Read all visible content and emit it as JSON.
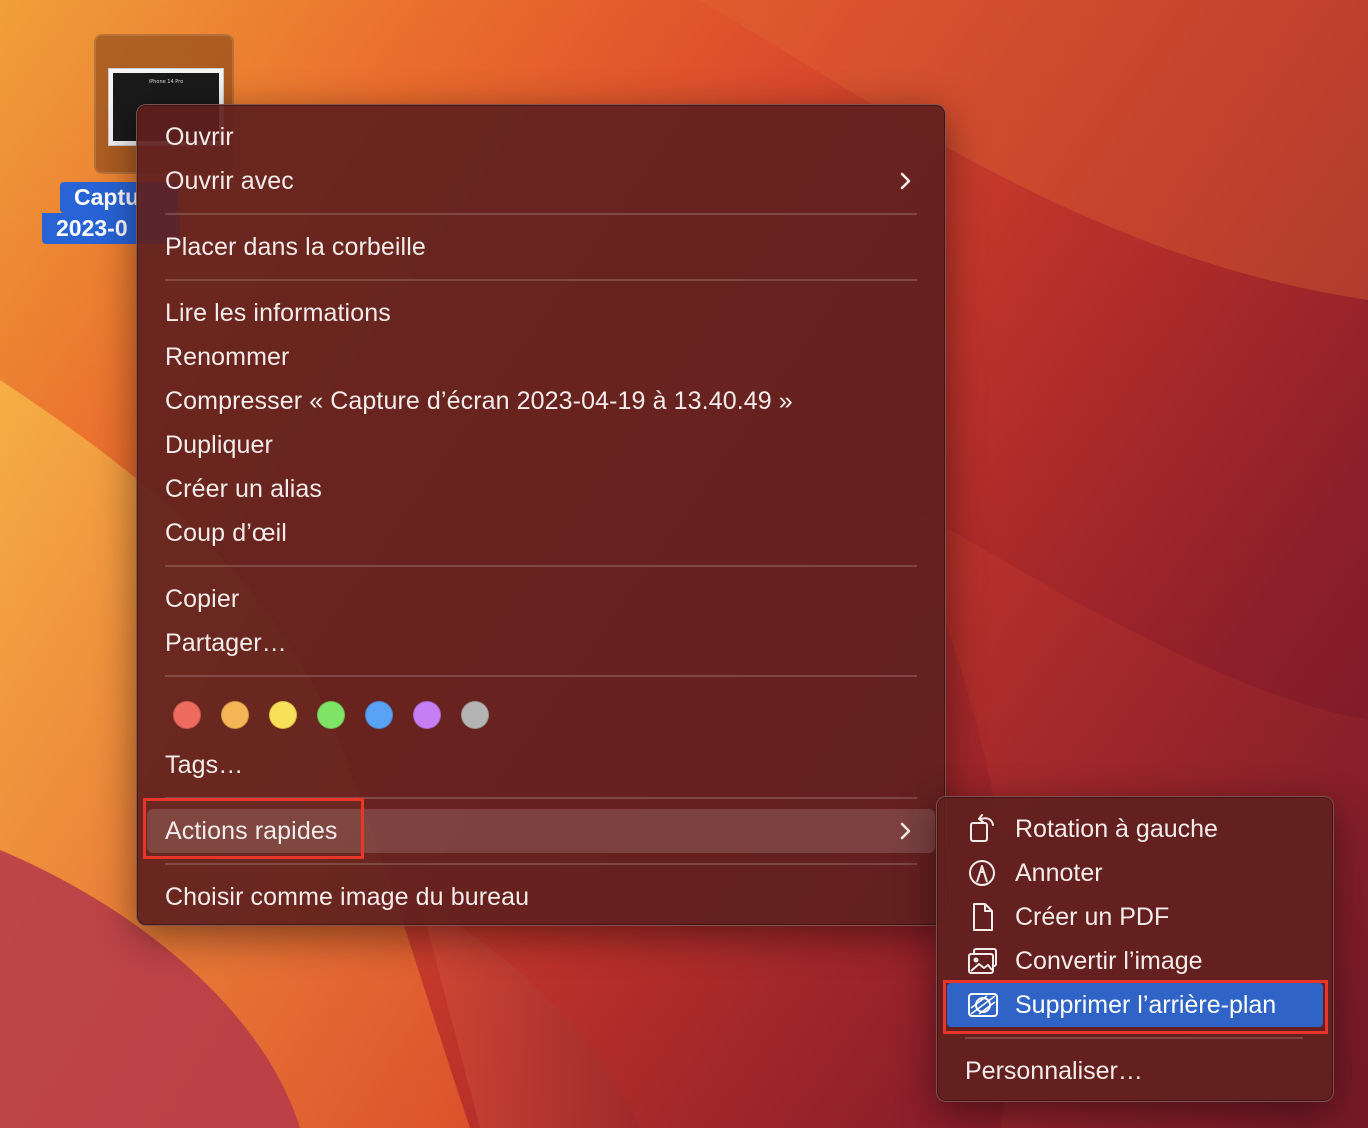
{
  "desktop_file": {
    "label_line1": "Captu",
    "label_line2": "2023-0",
    "thumb_text": "iPhone 14 Pro"
  },
  "context_menu": {
    "open": "Ouvrir",
    "open_with": "Ouvrir avec",
    "move_to_trash": "Placer dans la corbeille",
    "get_info": "Lire les informations",
    "rename": "Renommer",
    "compress": "Compresser « Capture d’écran 2023-04-19 à 13.40.49 »",
    "duplicate": "Dupliquer",
    "make_alias": "Créer un alias",
    "quick_look": "Coup d’œil",
    "copy": "Copier",
    "share": "Partager…",
    "tags": "Tags…",
    "quick_actions": "Actions rapides",
    "set_desktop_picture": "Choisir comme image du bureau",
    "tag_colors": [
      "#ee6b60",
      "#f5b455",
      "#f8e05a",
      "#7ee466",
      "#5aa2f6",
      "#c77df3",
      "#b4b4b4"
    ]
  },
  "quick_actions_menu": {
    "rotate_left": "Rotation à gauche",
    "markup": "Annoter",
    "create_pdf": "Créer un PDF",
    "convert_image": "Convertir l’image",
    "remove_background": "Supprimer l’arrière-plan",
    "customize": "Personnaliser…"
  },
  "colors": {
    "selection_blue": "#2f64c6",
    "annotation_red": "#e8372a"
  }
}
